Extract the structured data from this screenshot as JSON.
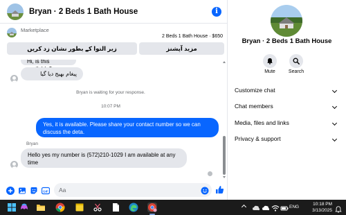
{
  "colors": {
    "accent": "#0866ff",
    "bubble_in": "#e4e6eb",
    "taskbar": "#1b1b1b"
  },
  "header": {
    "title": "Bryan · 2 Beds 1 Bath House",
    "info_icon": "info-icon",
    "info_glyph": "i"
  },
  "marketplace": {
    "label": "Marketplace",
    "listing": "2 Beds 1 Bath House · $650",
    "buttons": [
      {
        "label": "زیر التوا کے بطور نشان زد کریں"
      },
      {
        "label": "مزید آپشنز"
      }
    ]
  },
  "messages": {
    "incoming_1": "Hi, is this available?",
    "outgoing_urdu": "پیغام بھیج دیا گیا",
    "status": "Bryan is waiting for your response.",
    "timestamp": "10:07 PM",
    "outgoing_2": "Yes, it is available. Please share your contact number so we can discuss the deta.",
    "sender": "Bryan",
    "incoming_2": "Hello yes my number is (572)210-1029 I am available at any time"
  },
  "composer": {
    "placeholder": "Aa",
    "icons": [
      "plus-icon",
      "photo-icon",
      "sticker-icon",
      "gif-icon",
      "emoji-icon",
      "like-icon"
    ],
    "gif_label": "GIF"
  },
  "sidebar": {
    "title": "Bryan · 2 Beds 1 Bath House",
    "actions": [
      {
        "label": "Mute",
        "icon": "bell-icon"
      },
      {
        "label": "Search",
        "icon": "search-icon"
      }
    ],
    "sections": [
      {
        "label": "Customize chat"
      },
      {
        "label": "Chat members"
      },
      {
        "label": "Media, files and links"
      },
      {
        "label": "Privacy & support"
      }
    ]
  },
  "taskbar": {
    "lang": "ENG",
    "time": "10:18 PM",
    "date": "3/13/2025"
  }
}
